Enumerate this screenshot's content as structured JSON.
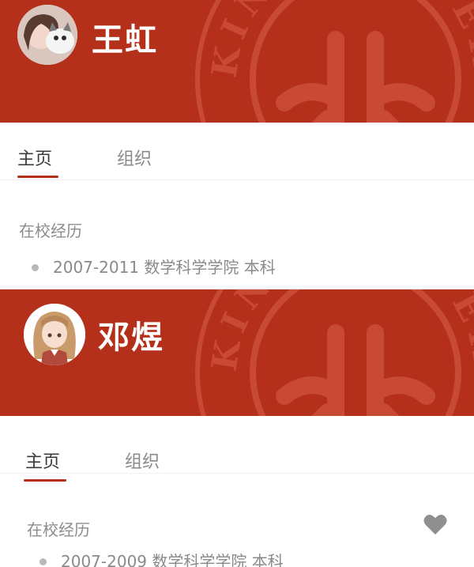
{
  "profiles": [
    {
      "name": "王虹",
      "tabs": [
        "主页",
        "组织"
      ],
      "section_title": "在校经历",
      "education": "2007-2011 数学科学学院 本科",
      "watermark_text": "KING UNIVERS"
    },
    {
      "name": "邓煜",
      "tabs": [
        "主页",
        "组织"
      ],
      "section_title": "在校经历",
      "education": "2007-2009 数学科学学院 本科",
      "watermark_text": "KING UNIVERS"
    }
  ],
  "colors": {
    "brand_red": "#b5301a",
    "watermark": "#c84a35",
    "text_gray": "#8a8a8a"
  },
  "icons": {
    "like": "heart-icon",
    "emblem": "university-emblem-icon"
  }
}
